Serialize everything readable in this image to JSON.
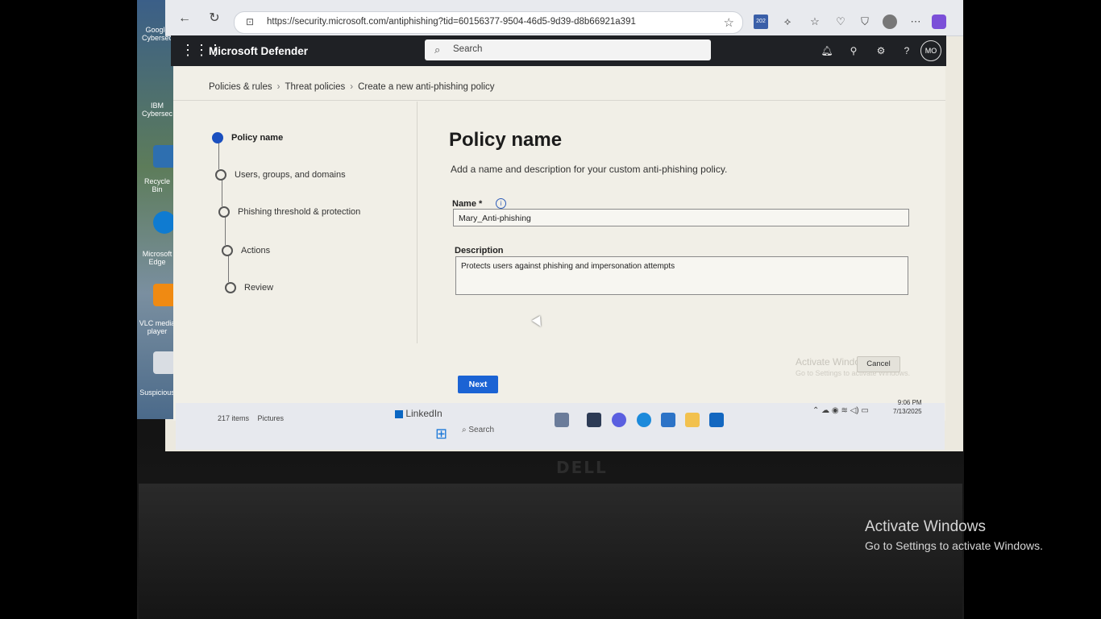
{
  "browser": {
    "url": "https://security.microsoft.com/antiphishing?tid=60156377-9504-46d5-9d39-d8b66921a391",
    "badge": "202"
  },
  "app": {
    "title": "Microsoft Defender",
    "search_placeholder": "Search",
    "avatar_initials": "MO"
  },
  "breadcrumb": [
    "Policies & rules",
    "Threat policies",
    "Create a new anti-phishing policy"
  ],
  "wizard_steps": [
    {
      "label": "Policy name",
      "active": true
    },
    {
      "label": "Users, groups, and domains",
      "active": false
    },
    {
      "label": "Phishing threshold & protection",
      "active": false
    },
    {
      "label": "Actions",
      "active": false
    },
    {
      "label": "Review",
      "active": false
    }
  ],
  "form": {
    "title": "Policy name",
    "description": "Add a name and description for your custom anti-phishing policy.",
    "name_label": "Name *",
    "name_value": "Mary_Anti-phishing",
    "description_label": "Description",
    "description_value": "Protects users against phishing and impersonation attempts",
    "next_label": "Next",
    "cancel_label": "Cancel"
  },
  "desktop": {
    "labels": [
      "Google Cybersec",
      "IBM Cybersec",
      "Recycle Bin",
      "Microsoft Edge",
      "VLC media player",
      "Suspicious"
    ]
  },
  "taskbar": {
    "explorer_items": "217 items",
    "explorer_folder": "Pictures",
    "linkedin": "LinkedIn",
    "search": "Search",
    "time": "9:06 PM",
    "date": "7/13/2025"
  },
  "watermark": {
    "title": "Activate Windows",
    "subtitle": "Go to Settings to activate Windows.",
    "inner_title": "Activate Windows",
    "inner_subtitle": "Go to Settings to activate Windows."
  },
  "laptop": {
    "brand": "DELL"
  }
}
